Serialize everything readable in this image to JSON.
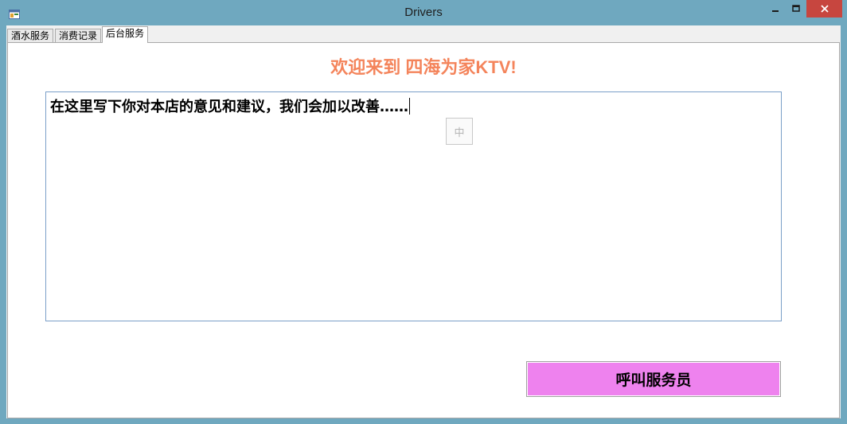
{
  "window": {
    "title": "Drivers",
    "minimize_glyph": "—",
    "maximize_glyph": "☐",
    "close_glyph": "✕"
  },
  "tabs": [
    {
      "label": "酒水服务",
      "active": false
    },
    {
      "label": "消费记录",
      "active": false
    },
    {
      "label": "后台服务",
      "active": true
    }
  ],
  "page": {
    "welcome": "欢迎来到 四海为家KTV!",
    "feedback_text": "在这里写下你对本店的意见和建议，我们会加以改善……",
    "ime_indicator": "中",
    "call_button": "呼叫服务员"
  },
  "colors": {
    "welcome": "#f4845b",
    "call_button_bg": "#ee82ee",
    "window_frame": "#6fa8bf",
    "close_button": "#c7463f"
  }
}
